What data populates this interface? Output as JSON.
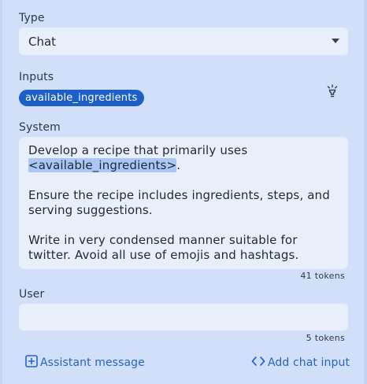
{
  "type_field": {
    "label": "Type",
    "value": "Chat"
  },
  "inputs_field": {
    "label": "Inputs",
    "chips": [
      "available_ingredients"
    ]
  },
  "system_field": {
    "label": "System",
    "lines": [
      "Develop a recipe that primarily uses",
      "<available_ingredients>",
      ".",
      "Ensure the recipe includes ingredients, steps, and",
      "serving suggestions.",
      "Write in very condensed manner suitable for",
      "twitter. Avoid all use of emojis and hashtags."
    ],
    "tokens": "41 tokens"
  },
  "user_field": {
    "label": "User",
    "value": "",
    "tokens": "5 tokens"
  },
  "actions": {
    "assistant_message": "Assistant message",
    "add_chat_input": "Add chat input"
  },
  "colors": {
    "panel_bg": "#d1e0f8",
    "field_bg": "#e8effa",
    "accent": "#1d5fc9",
    "link": "#2563c9",
    "highlight": "#a9c6f5"
  },
  "icons": {
    "select_caret": "caret-down-icon",
    "insert_input": "lightbulb-icon",
    "add_assistant": "plus-square-icon",
    "add_chat_input": "code-brackets-icon"
  }
}
